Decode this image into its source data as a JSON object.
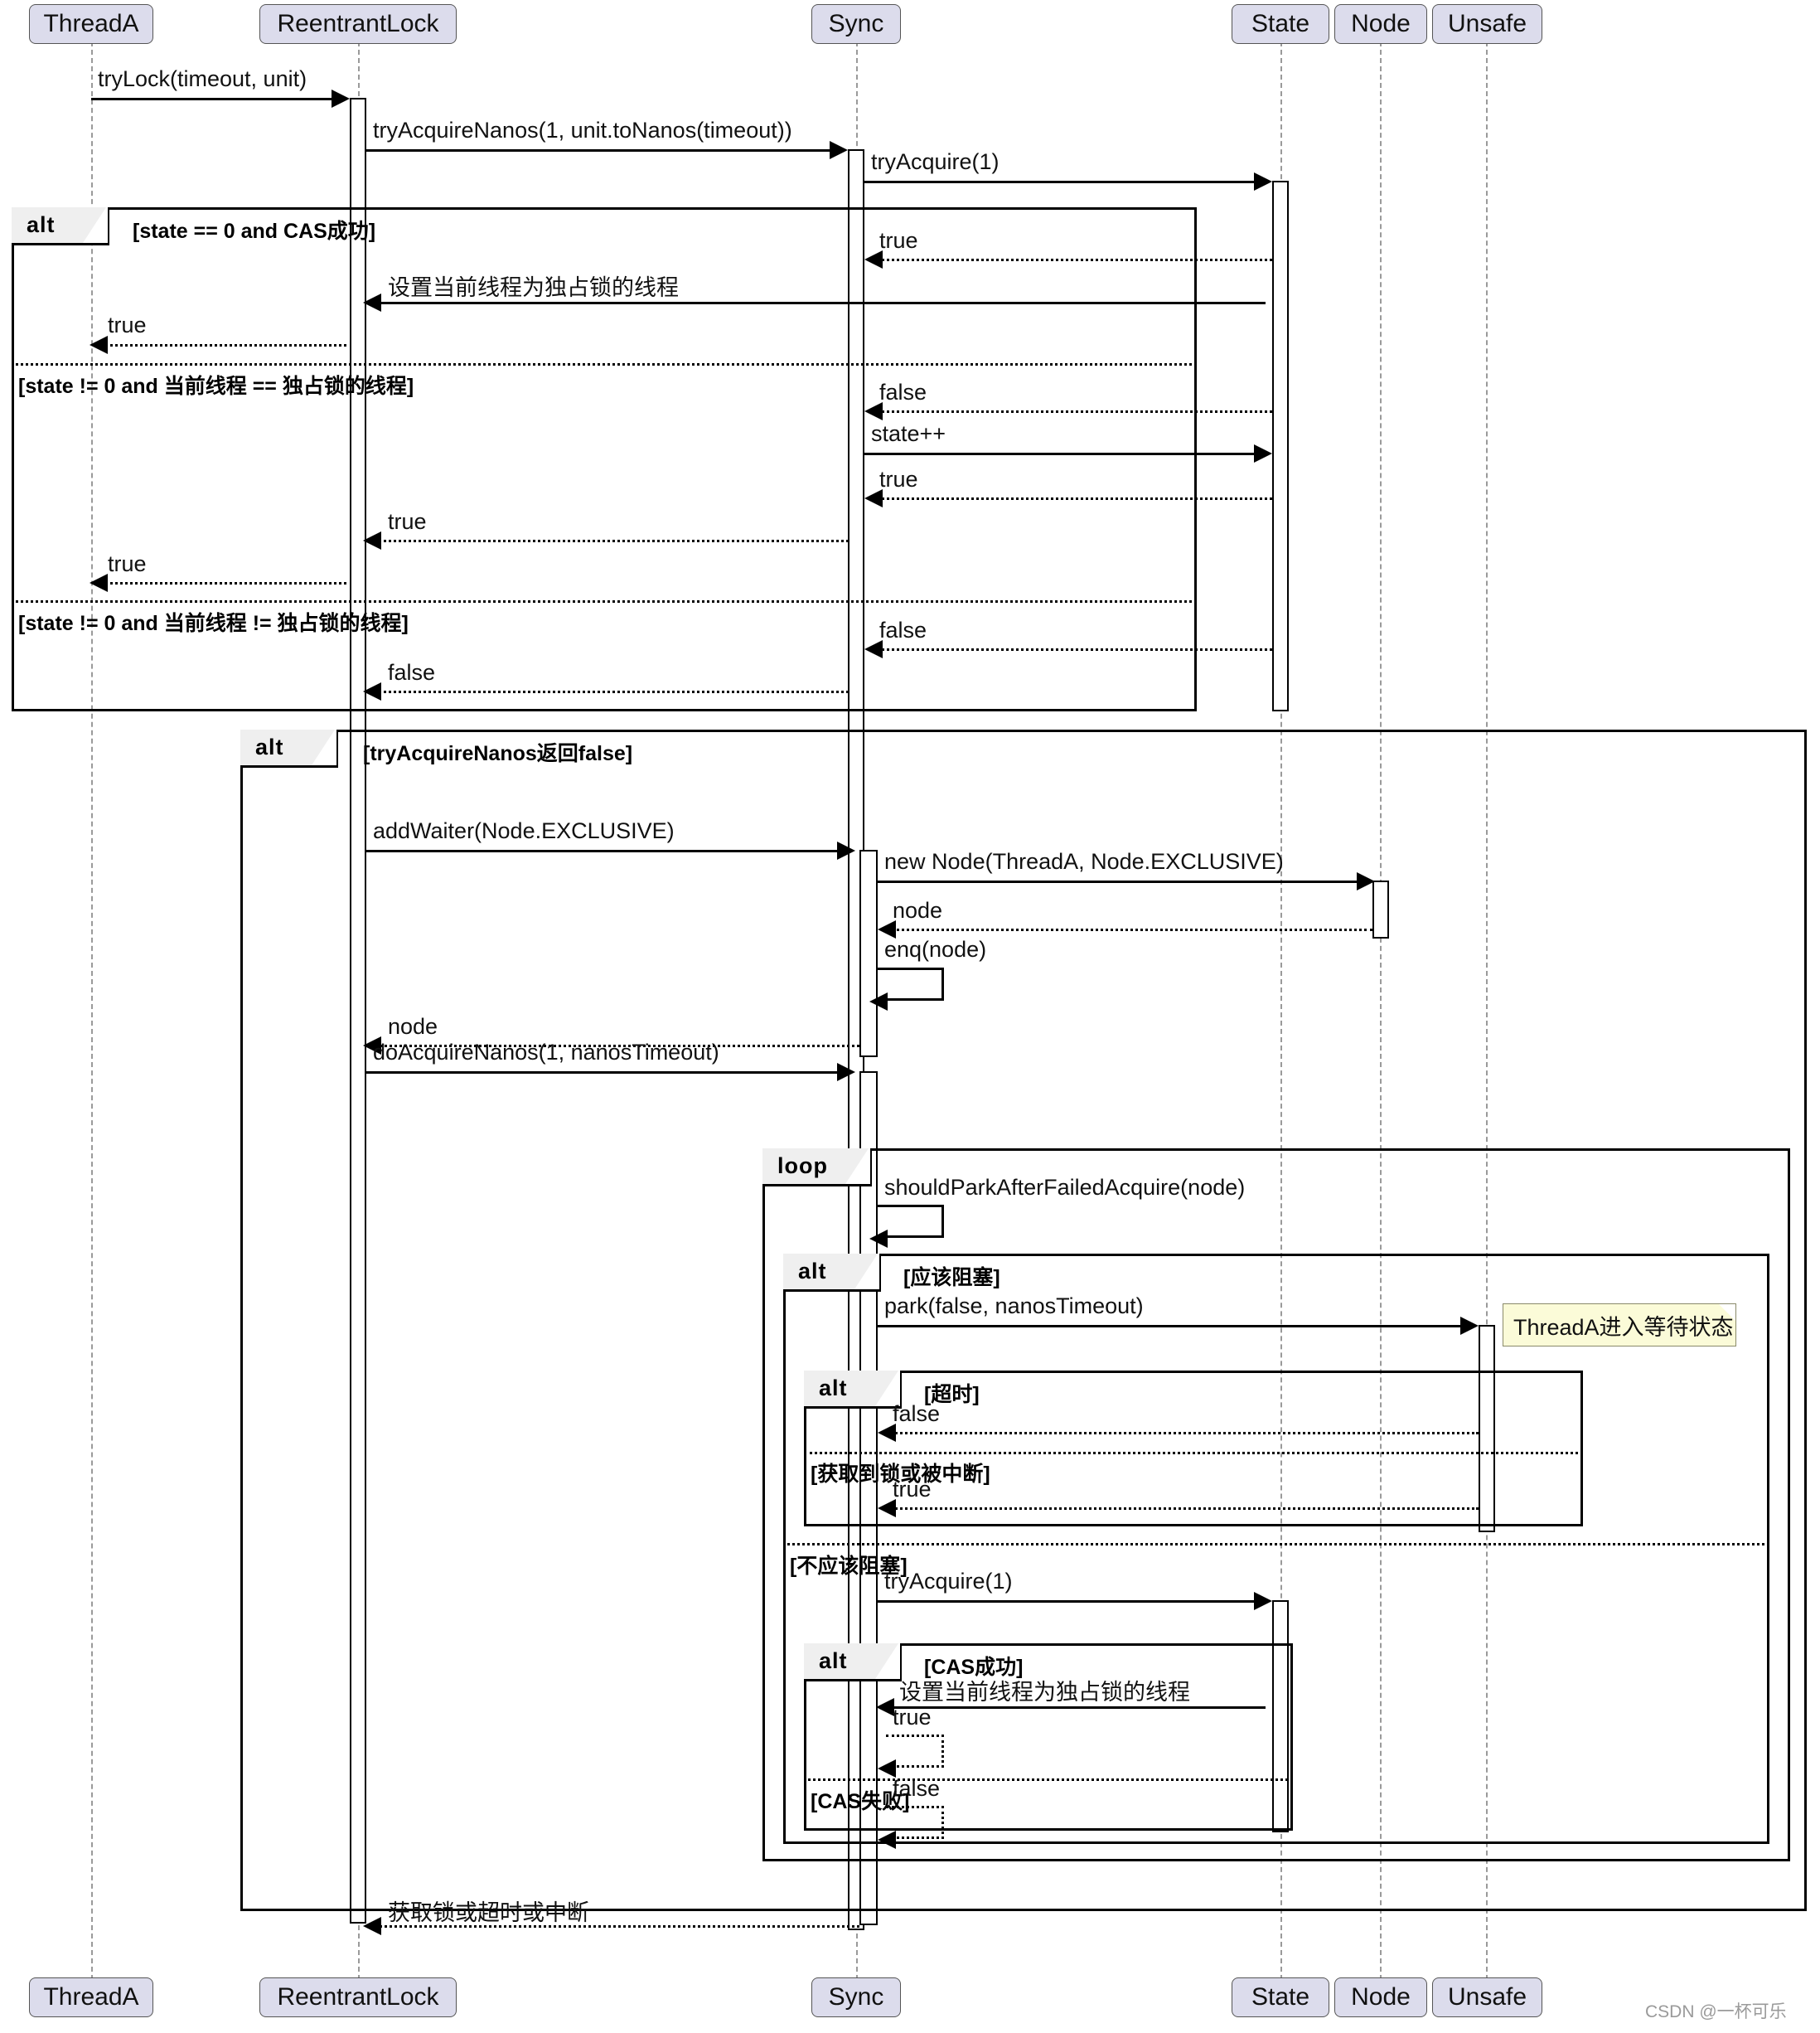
{
  "diagram": {
    "type": "uml-sequence-diagram",
    "title": "ReentrantLock tryLock(timeout, unit) sequence"
  },
  "participants": [
    {
      "id": "threadA",
      "label": "ThreadA"
    },
    {
      "id": "reentrantLock",
      "label": "ReentrantLock"
    },
    {
      "id": "sync",
      "label": "Sync"
    },
    {
      "id": "state",
      "label": "State"
    },
    {
      "id": "node",
      "label": "Node"
    },
    {
      "id": "unsafe",
      "label": "Unsafe"
    }
  ],
  "messages": {
    "tryLock": "tryLock(timeout, unit)",
    "tryAcquireNanos": "tryAcquireNanos(1, unit.toNanos(timeout))",
    "tryAcquire1_a": "tryAcquire(1)",
    "true_state_a": "true",
    "setExclusiveOwner_a": "设置当前线程为独占锁的线程",
    "true_to_thread_a": "true",
    "false_state_b": "false",
    "statePlusPlus": "state++",
    "true_state_b": "true",
    "true_to_lock_b": "true",
    "true_to_thread_b": "true",
    "false_state_c": "false",
    "false_to_lock_c": "false",
    "addWaiter": "addWaiter(Node.EXCLUSIVE)",
    "newNode": "new Node(ThreadA, Node.EXCLUSIVE)",
    "node_ret_from_node": "node",
    "enqNode": "enq(node)",
    "node_ret_to_lock": "node",
    "doAcquireNanos": "doAcquireNanos(1, nanosTimeout)",
    "shouldPark": "shouldParkAfterFailedAcquire(node)",
    "park": "park(false, nanosTimeout)",
    "false_timeout": "false",
    "true_acquired": "true",
    "tryAcquire1_b": "tryAcquire(1)",
    "setExclusiveOwner_b": "设置当前线程为独占锁的线程",
    "true_cas_ok": "true",
    "false_cas_fail": "false",
    "final_return": "获取锁或超时或中断"
  },
  "fragments": {
    "alt1": {
      "keyword": "alt",
      "conditions": [
        "[state == 0 and CAS成功]",
        "[state != 0 and 当前线程 == 独占锁的线程]",
        "[state != 0 and 当前线程 != 独占锁的线程]"
      ]
    },
    "alt2": {
      "keyword": "alt",
      "conditions": [
        "[tryAcquireNanos返回false]"
      ]
    },
    "loop1": {
      "keyword": "loop",
      "conditions": [
        ""
      ]
    },
    "alt3": {
      "keyword": "alt",
      "conditions": [
        "[应该阻塞]",
        "[不应该阻塞]"
      ]
    },
    "alt4": {
      "keyword": "alt",
      "conditions": [
        "[超时]",
        "[获取到锁或被中断]"
      ]
    },
    "alt5": {
      "keyword": "alt",
      "conditions": [
        "[CAS成功]",
        "[CAS失败]"
      ]
    }
  },
  "notes": {
    "park_note": "ThreadA进入等待状态"
  },
  "watermark": "CSDN @一杯可乐",
  "colors": {
    "participant_fill": "#dcdcec",
    "fragment_label_fill": "#efefef",
    "note_fill": "#fbfbd8",
    "line": "#000000",
    "lifeline": "#9a9a9a"
  }
}
